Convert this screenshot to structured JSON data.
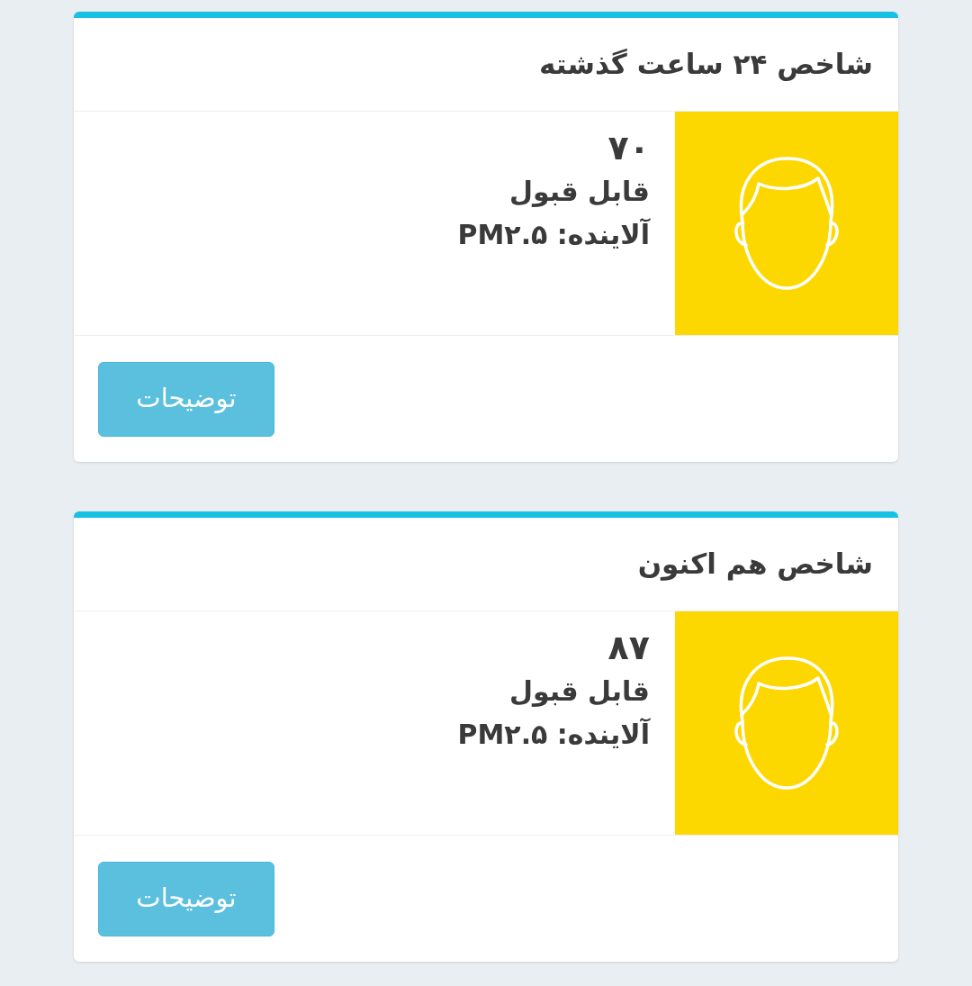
{
  "cards": [
    {
      "title": "شاخص ۲۴ ساعت گذشته",
      "value": "۷۰",
      "status": "قابل قبول",
      "pollutant": "آلاینده: PM۲.۵",
      "button": "توضیحات"
    },
    {
      "title": "شاخص هم اکنون",
      "value": "۸۷",
      "status": "قابل قبول",
      "pollutant": "آلاینده: PM۲.۵",
      "button": "توضیحات"
    }
  ]
}
